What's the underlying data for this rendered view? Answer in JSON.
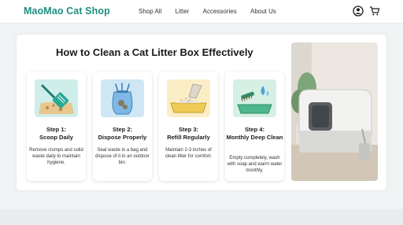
{
  "header": {
    "brand": "MaoMao Cat Shop",
    "nav": [
      "Shop All",
      "Litter",
      "Accessories",
      "About Us"
    ],
    "account_icon": "user-circle-icon",
    "cart_icon": "shopping-cart-icon"
  },
  "main": {
    "title": "How to Clean a Cat Litter Box Effectively",
    "steps": [
      {
        "label": "Step 1:",
        "name": "Scoop Daily",
        "desc": "Remove clumps and solid waste daily to maintain hygiene.",
        "icon": "scoop-icon"
      },
      {
        "label": "Step 2:",
        "name": "Dispose Properly",
        "desc": "Seal waste in a bag and dispose of it in an outdoor bin.",
        "icon": "waste-bag-icon"
      },
      {
        "label": "Step 3:",
        "name": "Refill Regularly",
        "desc": "Maintain 2-3 inches of clean litter for comfort.",
        "icon": "litter-tray-icon"
      },
      {
        "label": "Step 4:",
        "name": "Monthly Deep Clean",
        "desc": "Empty completely, wash with soap and warm water monthly.",
        "icon": "brush-and-tray-icon"
      }
    ],
    "photo": "covered-litter-box-photo"
  },
  "colors": {
    "brand": "#1f8f7f",
    "page_background": "#f1f4f4",
    "card_background": "#ffffff"
  }
}
